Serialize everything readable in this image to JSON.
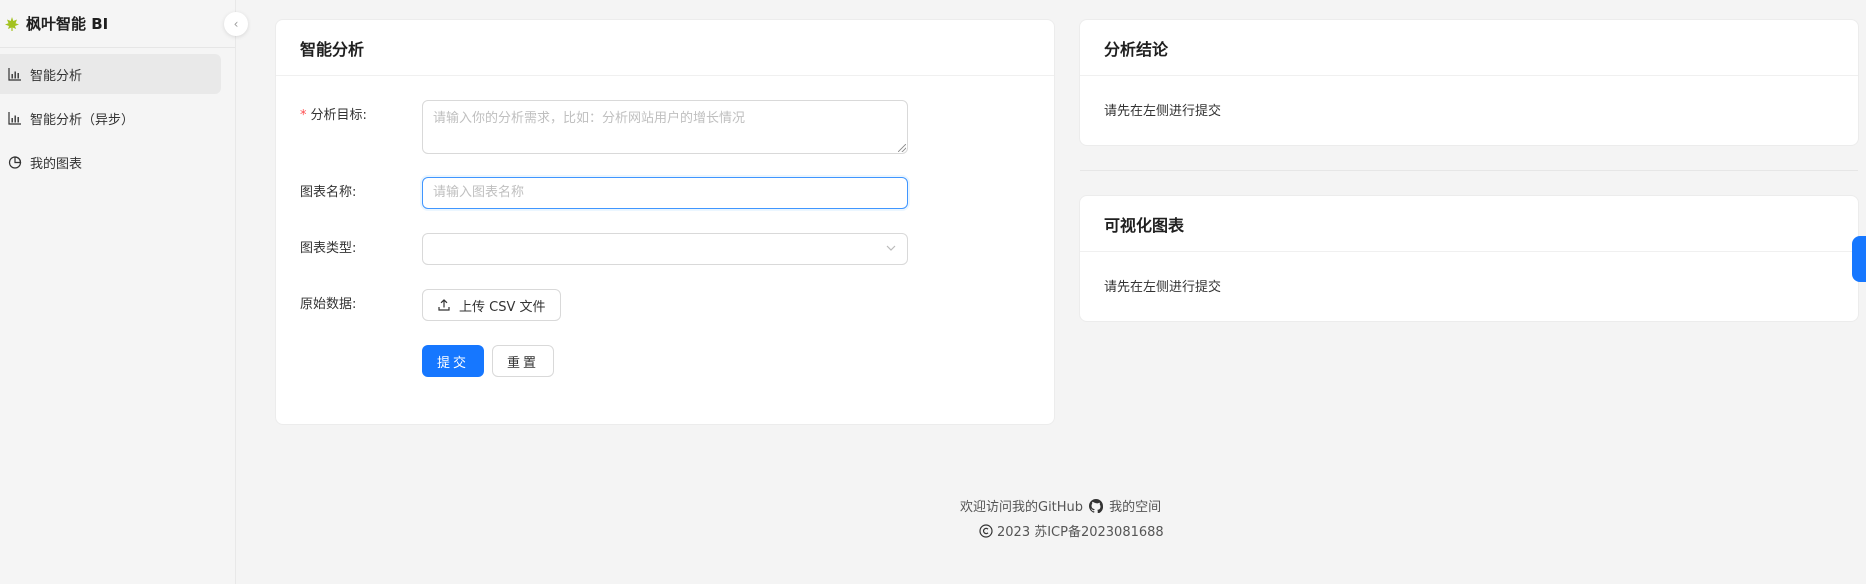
{
  "app": {
    "title": "枫叶智能 BI",
    "collapse_glyph": "‹"
  },
  "sidebar": {
    "items": [
      {
        "label": "智能分析",
        "icon": "bar-chart-icon",
        "active": true
      },
      {
        "label": "智能分析（异步）",
        "icon": "bar-chart-icon",
        "active": false
      },
      {
        "label": "我的图表",
        "icon": "pie-chart-icon",
        "active": false
      }
    ]
  },
  "analysis_card": {
    "title": "智能分析",
    "goal_required_mark": "*",
    "goal_label": "分析目标:",
    "goal_placeholder": "请输入你的分析需求，比如：分析网站用户的增长情况",
    "chart_name_label": "图表名称:",
    "chart_name_placeholder": "请输入图表名称",
    "chart_type_label": "图表类型:",
    "chart_type_value": "",
    "raw_data_label": "原始数据:",
    "upload_label": "上传 CSV 文件",
    "submit_label": "提交",
    "reset_label": "重置"
  },
  "conclusion_card": {
    "title": "分析结论",
    "text": "请先在左侧进行提交"
  },
  "chart_card": {
    "title": "可视化图表",
    "text": "请先在左侧进行提交"
  },
  "footer": {
    "github_text": "欢迎访问我的GitHub",
    "space_text": "我的空间",
    "copyright": "2023 苏ICP备2023081688"
  },
  "colors": {
    "primary": "#1677ff",
    "required": "#ff4d4f",
    "logo": "#a0c020"
  }
}
